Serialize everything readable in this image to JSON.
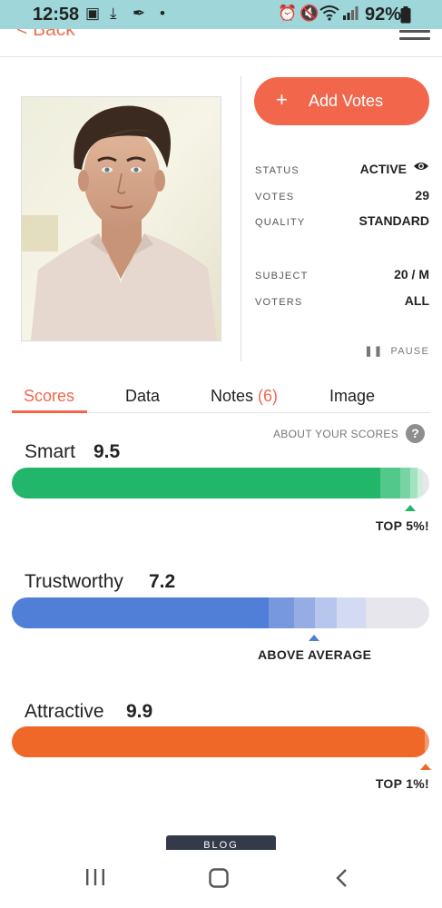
{
  "status_bar": {
    "time": "12:58",
    "battery": "92%"
  },
  "header": {
    "back_label": "< Back"
  },
  "profile": {
    "add_votes_label": "Add Votes",
    "info": [
      {
        "key": "STATUS",
        "value": "ACTIVE"
      },
      {
        "key": "VOTES",
        "value": "29"
      },
      {
        "key": "QUALITY",
        "value": "STANDARD"
      },
      {
        "key": "SUBJECT",
        "value": "20 / M"
      },
      {
        "key": "VOTERS",
        "value": "ALL"
      }
    ],
    "pause_label": "PAUSE"
  },
  "tabs": [
    {
      "label": "Scores",
      "active": true
    },
    {
      "label": "Data"
    },
    {
      "label": "Notes",
      "count": "(6)"
    },
    {
      "label": "Image"
    }
  ],
  "scores": {
    "about_label": "ABOUT YOUR SCORES",
    "items": [
      {
        "label": "Smart",
        "value": "9.5",
        "rank": "TOP 5%!",
        "color": "#22b66b",
        "fill_fraction": 0.95
      },
      {
        "label": "Trustworthy",
        "value": "7.2",
        "rank": "ABOVE AVERAGE",
        "color": "#4f7fd6",
        "fill_fraction": 0.72
      },
      {
        "label": "Attractive",
        "value": "9.9",
        "rank": "TOP 1%!",
        "color": "#f06828",
        "fill_fraction": 0.99
      }
    ]
  },
  "footer": {
    "blog_label": "BLOG"
  },
  "colors": {
    "accent": "#f2674c",
    "status_bar": "#9ed6da"
  }
}
